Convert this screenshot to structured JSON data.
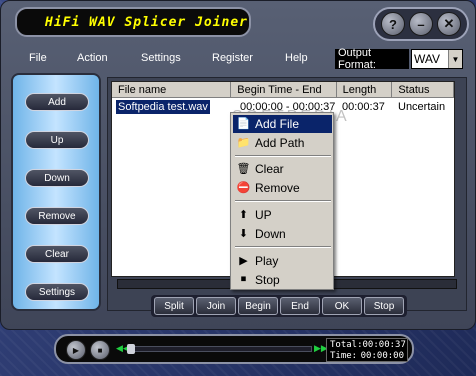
{
  "app": {
    "title": "HiFi WAV Splicer Joiner"
  },
  "window_controls": [
    {
      "name": "help-icon",
      "glyph": "?"
    },
    {
      "name": "minimize-icon",
      "glyph": "–"
    },
    {
      "name": "close-icon",
      "glyph": "✕"
    }
  ],
  "menu": [
    "File",
    "Action",
    "Settings",
    "Register",
    "Help"
  ],
  "output_format": {
    "label": "Output Format:",
    "value": "WAV"
  },
  "sidebar": {
    "buttons": [
      "Add",
      "Up",
      "Down",
      "Remove",
      "Clear",
      "Settings"
    ]
  },
  "table": {
    "columns": [
      "File name",
      "Begin Time - End",
      "Length",
      "Status"
    ],
    "rows": [
      {
        "file": "Softpedia test.wav",
        "time": "00:00:00 - 00:00:37",
        "length": "00:00:37",
        "status": "Uncertain"
      }
    ]
  },
  "watermark": "SOFTPEDIA",
  "bottom_buttons": [
    "Split",
    "Join",
    "Begin",
    "End",
    "OK",
    "Stop"
  ],
  "context_menu": [
    {
      "label": "Add File",
      "icon": "add-file-icon",
      "glyph": "📄",
      "highlighted": true
    },
    {
      "label": "Add Path",
      "icon": "add-path-icon",
      "glyph": "📁"
    },
    {
      "label": "Clear",
      "icon": "clear-icon",
      "glyph": "🗑"
    },
    {
      "label": "Remove",
      "icon": "remove-icon",
      "glyph": "⛔"
    },
    {
      "label": "UP",
      "icon": "up-arrow-icon",
      "glyph": "⬆"
    },
    {
      "label": "Down",
      "icon": "down-arrow-icon",
      "glyph": "⬇"
    },
    {
      "label": "Play",
      "icon": "play-icon",
      "glyph": "▶"
    },
    {
      "label": "Stop",
      "icon": "stop-icon",
      "glyph": "⏹"
    }
  ],
  "player": {
    "total_label": "Total:",
    "total_value": "00:00:37",
    "time_label": "Time:",
    "time_value": "00:00:00"
  },
  "colors": {
    "title_text": "#ffff00",
    "selection": "#0a246a",
    "sidebar_panel": "#a8d4f8"
  }
}
